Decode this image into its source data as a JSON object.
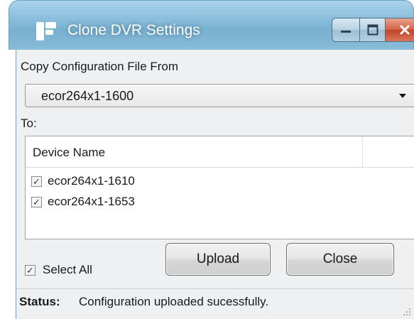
{
  "window": {
    "title": "Clone DVR Settings",
    "icons": {
      "app": "app-icon",
      "minimize": "minimize-icon",
      "maximize": "maximize-icon",
      "close": "close-icon"
    }
  },
  "source": {
    "label": "Copy Configuration File From",
    "selected": "ecor264x1-1600"
  },
  "target": {
    "label": "To:",
    "columns": [
      "Device Name"
    ],
    "devices": [
      {
        "name": "ecor264x1-1610",
        "checked": true
      },
      {
        "name": "ecor264x1-1653",
        "checked": true
      }
    ]
  },
  "select_all": {
    "label": "Select All",
    "checked": true
  },
  "buttons": {
    "upload": "Upload",
    "close": "Close"
  },
  "status": {
    "label": "Status:",
    "text": "Configuration uploaded sucessfully."
  },
  "colors": {
    "title_bar": "#8cbfdc",
    "close_button": "#d4644a",
    "client_bg": "#eff0f1"
  }
}
